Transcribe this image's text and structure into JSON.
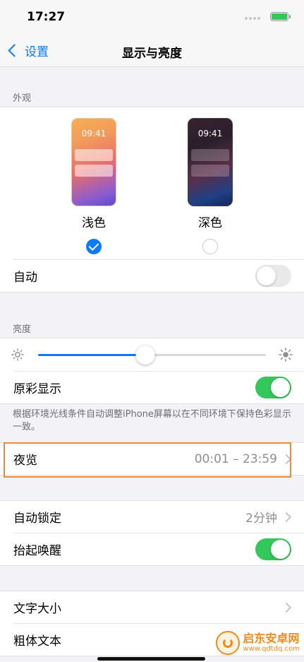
{
  "status_bar": {
    "time": "17:27"
  },
  "nav": {
    "back_label": "设置",
    "title": "显示与亮度"
  },
  "appearance": {
    "header": "外观",
    "light": {
      "phone_time": "09:41",
      "label": "浅色",
      "selected": true
    },
    "dark": {
      "phone_time": "09:41",
      "label": "深色",
      "selected": false
    },
    "auto_label": "自动",
    "auto_on": false
  },
  "brightness": {
    "header": "亮度",
    "level_fraction": 0.47,
    "true_tone_label": "原彩显示",
    "true_tone_on": true,
    "footnote": "根据环境光线条件自动调整iPhone屏幕以在不同环境下保持色彩显示一致。"
  },
  "night_shift": {
    "label": "夜览",
    "value": "00:01 – 23:59"
  },
  "lock": {
    "auto_lock_label": "自动锁定",
    "auto_lock_value": "2分钟",
    "raise_to_wake_label": "抬起唤醒",
    "raise_to_wake_on": true
  },
  "text": {
    "text_size_label": "文字大小",
    "bold_text_label": "粗体文本"
  },
  "watermark": {
    "name": "启东安卓网",
    "url": "www.qdtdq.com"
  },
  "colors": {
    "accent": "#0a7aff",
    "toggle_on": "#34c759",
    "highlight_border": "#e98d3a"
  }
}
